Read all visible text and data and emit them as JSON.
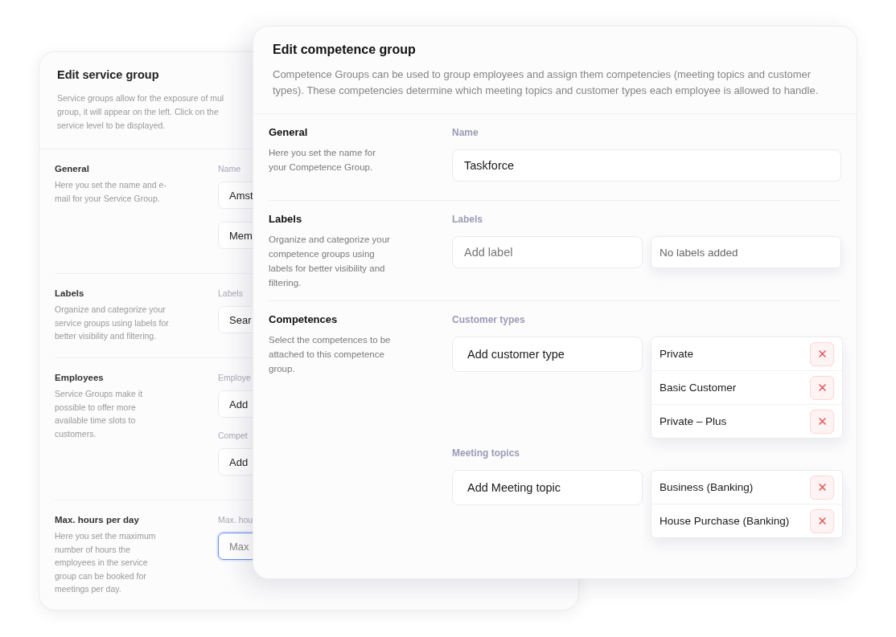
{
  "service_group_card": {
    "title": "Edit service group",
    "description_lines": [
      "Service groups allow for the exposure of mul",
      "group, it will appear on the left. Click on the",
      "service level to be displayed."
    ],
    "sections": [
      {
        "heading": "General",
        "description": "Here you set the name and e-mail for your Service Group.",
        "fields": [
          {
            "label": "Name",
            "value": "Amst"
          },
          {
            "value": "Mem"
          }
        ]
      },
      {
        "heading": "Labels",
        "description": "Organize and categorize your service groups using labels for better visibility and filtering.",
        "fields": [
          {
            "label": "Labels",
            "value": "Sear"
          }
        ]
      },
      {
        "heading": "Employees",
        "description": "Service Groups make it possible to offer more available time slots to customers.",
        "fields": [
          {
            "label": "Employe",
            "value": "Add"
          },
          {
            "label": "Compet",
            "value": "Add"
          }
        ]
      },
      {
        "heading": "Max. hours per day",
        "description": "Here you set the maximum number of hours the employees in the service group can be booked for meetings per day.",
        "fields": [
          {
            "label": "Max. hou",
            "placeholder": "Max",
            "focused": true
          }
        ]
      }
    ]
  },
  "competence_group_card": {
    "title": "Edit competence group",
    "description": "Competence Groups can be used to group employees and assign them competencies (meeting topics and customer types). These competencies determine which meeting topics and customer types each employee is allowed to handle.",
    "sections": [
      {
        "heading": "General",
        "description": "Here you set the name for your Competence Group.",
        "groups": [
          {
            "label": "Name",
            "field": {
              "value": "Taskforce"
            }
          }
        ]
      },
      {
        "heading": "Labels",
        "description": "Organize and categorize your competence groups using labels for better visibility and filtering.",
        "groups": [
          {
            "label": "Labels",
            "field": {
              "placeholder": "Add label"
            },
            "empty_text": "No labels added"
          }
        ]
      },
      {
        "heading": "Competences",
        "description": "Select the competences to be attached to this competence group.",
        "groups": [
          {
            "label": "Customer types",
            "field": {
              "value": "Add customer type"
            },
            "items": [
              "Private",
              "Basic Customer",
              "Private – Plus"
            ]
          },
          {
            "label": "Meeting topics",
            "field": {
              "value": "Add Meeting topic"
            },
            "items": [
              "Business (Banking)",
              "House Purchase (Banking)"
            ]
          }
        ]
      }
    ]
  }
}
